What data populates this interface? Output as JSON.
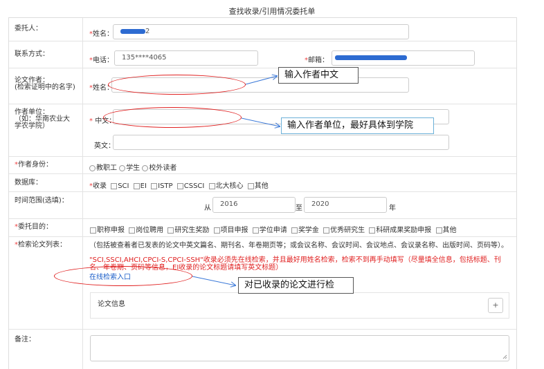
{
  "page_title": "查找收录/引用情况委托单",
  "client": {
    "label": "委托人：",
    "name_label": "姓名：",
    "name_suffix": "2"
  },
  "contact": {
    "label": "联系方式：",
    "phone_label": "电话：",
    "phone_value": "135****4065",
    "email_label": "邮箱："
  },
  "author": {
    "label": "论文作者：",
    "sublabel": "(检索证明中的名字)",
    "name_label": "姓名："
  },
  "affiliation": {
    "label": "作者单位：",
    "sublabel": "（如：华南农业大学农学院）",
    "cn_label": "中文：",
    "en_label": "英文："
  },
  "identity": {
    "label": "作者身份：",
    "options": [
      "教职工",
      "学生",
      "校外读者"
    ]
  },
  "database": {
    "label": "数据库：",
    "options": [
      "收录",
      "SCI",
      "EI",
      "ISTP",
      "CSSCI",
      "北大核心",
      "其他"
    ]
  },
  "time_range": {
    "label": "时间范围(选填)：",
    "from_label": "从",
    "from_value": "2016",
    "to_label": "至",
    "to_value": "2020",
    "unit": "年"
  },
  "purpose": {
    "label": "委托目的：",
    "options": [
      "职称申报",
      "岗位聘用",
      "研究生奖励",
      "项目申报",
      "学位申请",
      "奖学金",
      "优秀研究生",
      "科研成果奖励申报",
      "其他"
    ]
  },
  "paper_list": {
    "label": "检索论文列表：",
    "instruction": "（包括被查着者已发表的论文中英文篇名、期刊名、年卷期页等；或会议名称、会议时间、会议地点、会议录名称、出版时间、页码等）。",
    "warning": "\"SCI,SSCI,AHCI,CPCI-S,CPCI-SSH\"收录必须先在线检索，并且最好用姓名检索，检索不到再手动填写（尽量填全信息，包括标题、刊名、年卷期、页码等信息，EI收录的论文标题请填写英文标题）",
    "search_link": "在线检索入口",
    "paper_info_label": "论文信息",
    "add_button": "+"
  },
  "remarks": {
    "label": "备注："
  },
  "callouts": {
    "author": "输入作者中文",
    "affiliation": "输入作者单位，最好具体到学院",
    "search": "对已收录的论文进行检"
  },
  "colors": {
    "required": "#e44444",
    "warning": "#e02020",
    "link": "#1a5dc8",
    "annotation": "#e02020",
    "arrow": "#3a78d8",
    "mask": "#2d6bd1"
  }
}
